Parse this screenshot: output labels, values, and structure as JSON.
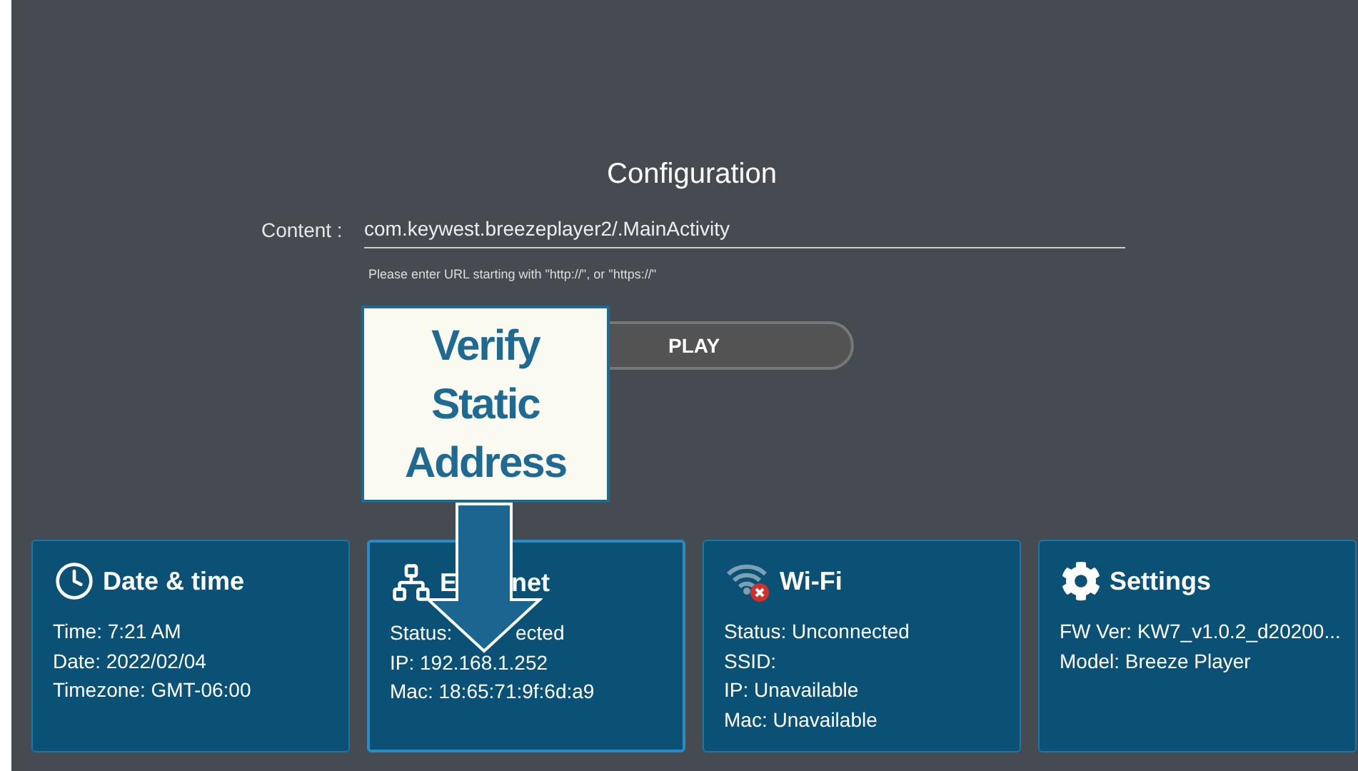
{
  "config": {
    "title": "Configuration",
    "content_label": "Content :",
    "content_value": "com.keywest.breezeplayer2/.MainActivity",
    "hint": "Please enter URL starting with \"http://\", or \"https://\"",
    "play_button": "PLAY"
  },
  "callout": {
    "lines": [
      "Verify",
      "Static",
      "Address"
    ]
  },
  "cards": [
    {
      "kind": "clock",
      "selected": false,
      "title": [
        "Date & time"
      ],
      "lines": [
        [
          "Time: 7:21 AM"
        ],
        [
          "Date: 2022/02/04"
        ],
        [
          "Timezone: GMT-06:00"
        ]
      ]
    },
    {
      "kind": "network",
      "selected": true,
      "title": [
        "E",
        "net"
      ],
      "lines": [
        [
          "Status:",
          "ected"
        ],
        [
          "IP: 192.168.1.252"
        ],
        [
          "Mac: 18:65:71:9f:6d:a9"
        ]
      ]
    },
    {
      "kind": "wifi_off",
      "selected": false,
      "title": [
        "Wi-Fi"
      ],
      "lines": [
        [
          "Status: Unconnected"
        ],
        [
          "SSID:"
        ],
        [
          "IP: Unavailable"
        ],
        [
          "Mac: Unavailable"
        ]
      ]
    },
    {
      "kind": "gear",
      "selected": false,
      "title": [
        "Settings"
      ],
      "lines": [
        [
          "FW Ver: KW7_v1.0.2_d20200..."
        ],
        [
          "Model: Breeze Player"
        ]
      ]
    }
  ]
}
